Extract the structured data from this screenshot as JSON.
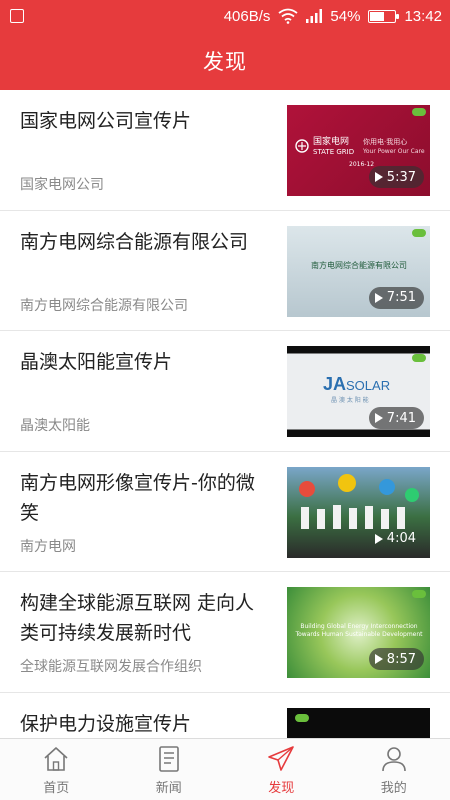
{
  "status_bar": {
    "speed": "406B/s",
    "battery_percent": "54%",
    "battery_level": 0.54,
    "time": "13:42"
  },
  "header": {
    "title": "发现"
  },
  "videos": [
    {
      "title": "国家电网公司宣传片",
      "source": "国家电网公司",
      "duration": "5:37",
      "thumb_text": [
        "国家电网",
        "STATE GRID",
        "你用电·我用心",
        "Your Power  Our Care",
        "2016-12"
      ]
    },
    {
      "title": "南方电网综合能源有限公司",
      "source": "南方电网综合能源有限公司",
      "duration": "7:51",
      "thumb_text": [
        "南方电网综合能源有限公司"
      ]
    },
    {
      "title": "晶澳太阳能宣传片",
      "source": "晶澳太阳能",
      "duration": "7:41",
      "thumb_text": [
        "JA",
        "SOLAR",
        "晶 澳 太 阳 能"
      ]
    },
    {
      "title": "南方电网形像宣传片-你的微笑",
      "source": "南方电网",
      "duration": "4:04",
      "thumb_text": []
    },
    {
      "title": "构建全球能源互联网 走向人类可持续发展新时代",
      "source": "全球能源互联网发展合作组织",
      "duration": "8:57",
      "thumb_text": [
        "Building Global Energy Interconnection",
        "Towards Human Sustainable Development"
      ]
    },
    {
      "title": "保护电力设施宣传片",
      "source": "",
      "duration": "",
      "thumb_text": []
    }
  ],
  "tabs": [
    {
      "label": "首页",
      "icon": "home-icon",
      "active": false
    },
    {
      "label": "新闻",
      "icon": "news-icon",
      "active": false
    },
    {
      "label": "发现",
      "icon": "discover-icon",
      "active": true
    },
    {
      "label": "我的",
      "icon": "profile-icon",
      "active": false
    }
  ],
  "colors": {
    "brand_red": "#e63b3d",
    "text_dark": "#222222",
    "text_muted": "#8a8a8a"
  }
}
